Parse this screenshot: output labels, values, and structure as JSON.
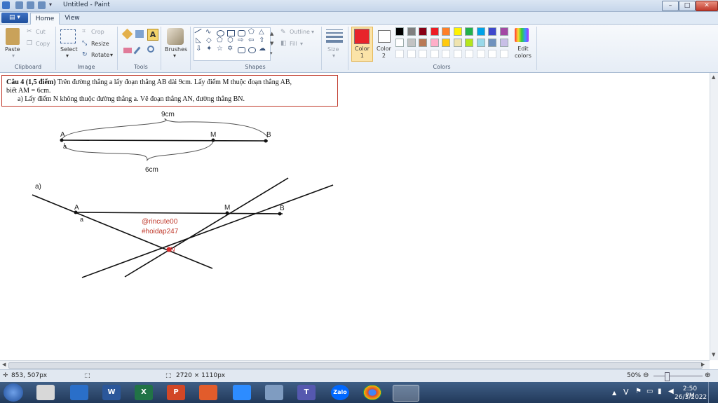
{
  "window": {
    "title": "Untitled - Paint",
    "buttons": {
      "minimize": "–",
      "maximize": "□",
      "close": "✕"
    }
  },
  "tabs": {
    "file": "▤ ▾",
    "home": "Home",
    "view": "View"
  },
  "ribbon": {
    "clipboard": {
      "paste": "Paste",
      "cut": "Cut",
      "copy": "Copy",
      "group": "Clipboard"
    },
    "image": {
      "select": "Select",
      "crop": "Crop",
      "resize": "Resize",
      "rotate": "Rotate",
      "group": "Image"
    },
    "tools": {
      "group": "Tools"
    },
    "brushes": {
      "label": "Brushes"
    },
    "shapes": {
      "outline": "Outline",
      "fill": "Fill",
      "group": "Shapes"
    },
    "size": {
      "label": "Size"
    },
    "colors": {
      "color1": "Color\n1",
      "color2": "Color\n2",
      "edit": "Edit\ncolors",
      "group": "Colors",
      "color1_value": "#e8242b",
      "color2_value": "#ffffff",
      "palette_row1": [
        "#000000",
        "#7f7f7f",
        "#880015",
        "#ed1c24",
        "#ff7f27",
        "#fff200",
        "#22b14c",
        "#00a2e8",
        "#3f48cc",
        "#a349a4"
      ],
      "palette_row2": [
        "#ffffff",
        "#c3c3c3",
        "#b97a57",
        "#ffaec9",
        "#ffc90e",
        "#efe4b0",
        "#b5e61d",
        "#99d9ea",
        "#7092be",
        "#c8bfe7"
      ]
    }
  },
  "question": {
    "heading": "Câu 4 (1,5 điểm)",
    "line1": " Trên đường thẳng a lấy đoạn thẳng AB dài 9cm. Lấy điểm M thuộc đoạn thẳng AB,",
    "line2": "biết AM = 6cm.",
    "line3": "a)   Lấy điểm N không thuộc đường thẳng a. Vẽ đoạn thẳng AN, đường thẳng BN."
  },
  "drawing": {
    "label_9cm": "9cm",
    "label_6cm": "6cm",
    "label_a_part": "a)",
    "point_A": "A",
    "point_M": "M",
    "point_B": "B",
    "point_N": "N",
    "line_a": "a",
    "watermark1": "@rincute00",
    "watermark2": "#hoidap247"
  },
  "status": {
    "cursor": "853, 507px",
    "size": "2720 × 1110px",
    "zoom": "50%"
  },
  "taskbar": {
    "time": "2:50 PM",
    "date": "26/3/2022",
    "lang": "V",
    "zalo": "Zalo"
  }
}
